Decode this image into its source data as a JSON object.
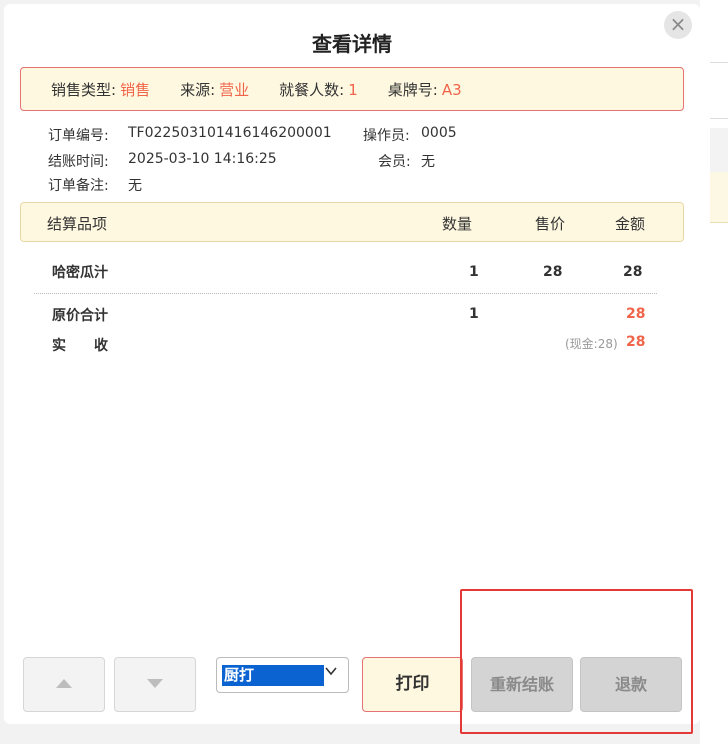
{
  "title": "查看详情",
  "close_label": "×",
  "banner": {
    "sale_type_label": "销售类型:",
    "sale_type_value": "销售",
    "source_label": "来源:",
    "source_value": "营业",
    "guests_label": "就餐人数:",
    "guests_value": "1",
    "table_label": "桌牌号:",
    "table_value": "A3"
  },
  "details": {
    "order_no_label": "订单编号:",
    "order_no_value": "TF022503101416146200001",
    "operator_label": "操作员:",
    "operator_value": "0005",
    "checkout_time_label": "结账时间:",
    "checkout_time_value": "2025-03-10 14:16:25",
    "member_label": "会员:",
    "member_value": "无",
    "remark_label": "订单备注:",
    "remark_value": "无"
  },
  "items_header": {
    "item": "结算品项",
    "qty": "数量",
    "price": "售价",
    "amount": "金额"
  },
  "items": [
    {
      "name": "哈密瓜汁",
      "qty": "1",
      "price": "28",
      "amount": "28"
    }
  ],
  "summary": {
    "original_total_label": "原价合计",
    "original_total_qty": "1",
    "original_total_amount": "28",
    "paid_label": "实　　收",
    "paid_note": "(现金:28)",
    "paid_amount": "28"
  },
  "footer": {
    "print_option": "厨打",
    "print_label": "打印",
    "recheckout_label": "重新结账",
    "refund_label": "退款"
  },
  "icons": {
    "up": "arrow-up-icon",
    "down": "arrow-down-icon",
    "chevron": "chevron-down-icon",
    "close": "close-icon"
  },
  "colors": {
    "accent_red": "#f0644a",
    "banner_bg": "#fff8e1",
    "highlight": "#e53935",
    "select_bg": "#0a63d1"
  }
}
